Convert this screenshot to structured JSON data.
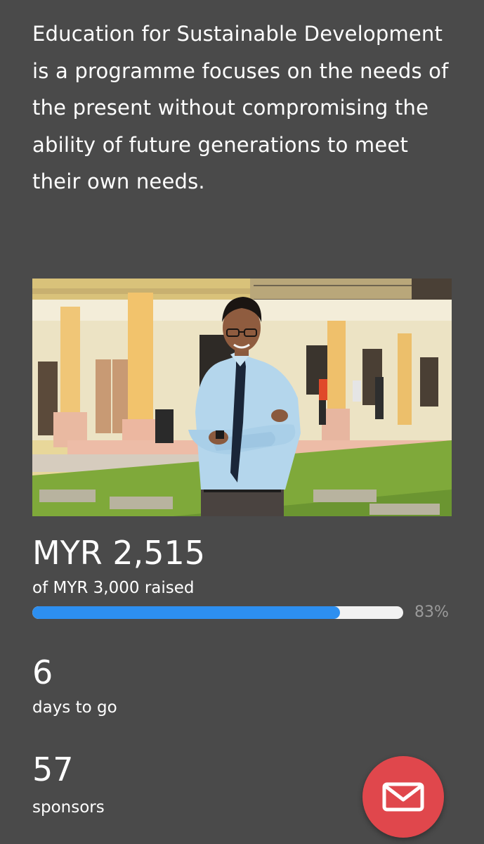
{
  "description": "Education for Sustainable Development is a programme focuses on the needs of the present without compromising the ability of future generations to meet their own needs.",
  "funding": {
    "raised": "MYR 2,515",
    "goal_text": "of MYR 3,000 raised",
    "percent_label": "83%",
    "progress_fraction": 0.83
  },
  "stats": {
    "days_value": "6",
    "days_label": "days to go",
    "sponsors_value": "57",
    "sponsors_label": "sponsors"
  },
  "colors": {
    "background": "#4a4a4a",
    "progress_fill": "#2d8ff0",
    "progress_track": "#f2f2f2",
    "fab": "#e0474c"
  },
  "icons": {
    "fab_icon": "envelope-icon"
  }
}
